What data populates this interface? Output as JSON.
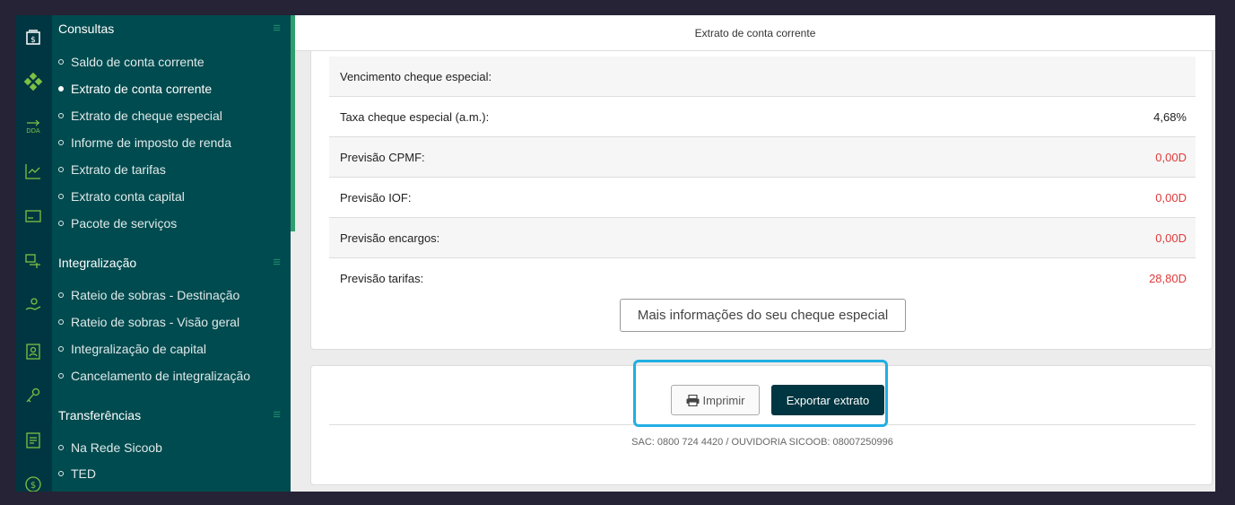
{
  "menu": {
    "sections": [
      {
        "title": "Consultas",
        "items": [
          {
            "label": "Saldo de conta corrente",
            "active": false
          },
          {
            "label": "Extrato de conta corrente",
            "active": true
          },
          {
            "label": "Extrato de cheque especial",
            "active": false
          },
          {
            "label": "Informe de imposto de renda",
            "active": false
          },
          {
            "label": "Extrato de tarifas",
            "active": false
          },
          {
            "label": "Extrato conta capital",
            "active": false
          },
          {
            "label": "Pacote de serviços",
            "active": false
          }
        ]
      },
      {
        "title": "Integralização",
        "items": [
          {
            "label": "Rateio de sobras - Destinação",
            "active": false
          },
          {
            "label": "Rateio de sobras - Visão geral",
            "active": false
          },
          {
            "label": "Integralização de capital",
            "active": false
          },
          {
            "label": "Cancelamento de integralização",
            "active": false
          }
        ]
      },
      {
        "title": "Transferências",
        "items": [
          {
            "label": "Na Rede Sicoob",
            "active": false
          },
          {
            "label": "TED",
            "active": false
          }
        ]
      }
    ]
  },
  "page_title": "Extrato de conta corrente",
  "rows": [
    {
      "label": "Vencimento cheque especial:",
      "value": "",
      "negative": false
    },
    {
      "label": "Taxa cheque especial (a.m.):",
      "value": "4,68%",
      "negative": false
    },
    {
      "label": "Previsão CPMF:",
      "value": "0,00D",
      "negative": true
    },
    {
      "label": "Previsão IOF:",
      "value": "0,00D",
      "negative": true
    },
    {
      "label": "Previsão encargos:",
      "value": "0,00D",
      "negative": true
    },
    {
      "label": "Previsão tarifas:",
      "value": "28,80D",
      "negative": true
    }
  ],
  "more_info_button": "Mais informações do seu cheque especial",
  "print_button": "Imprimir",
  "export_button": "Exportar extrato",
  "sac_text": "SAC: 0800 724 4420 / OUVIDORIA SICOOB: 08007250996",
  "colors": {
    "sidebar_dark": "#003641",
    "menu_bg": "#004b4f",
    "accent_green": "#7cc243",
    "negative": "#e03a3a",
    "highlight": "#21aee3"
  }
}
